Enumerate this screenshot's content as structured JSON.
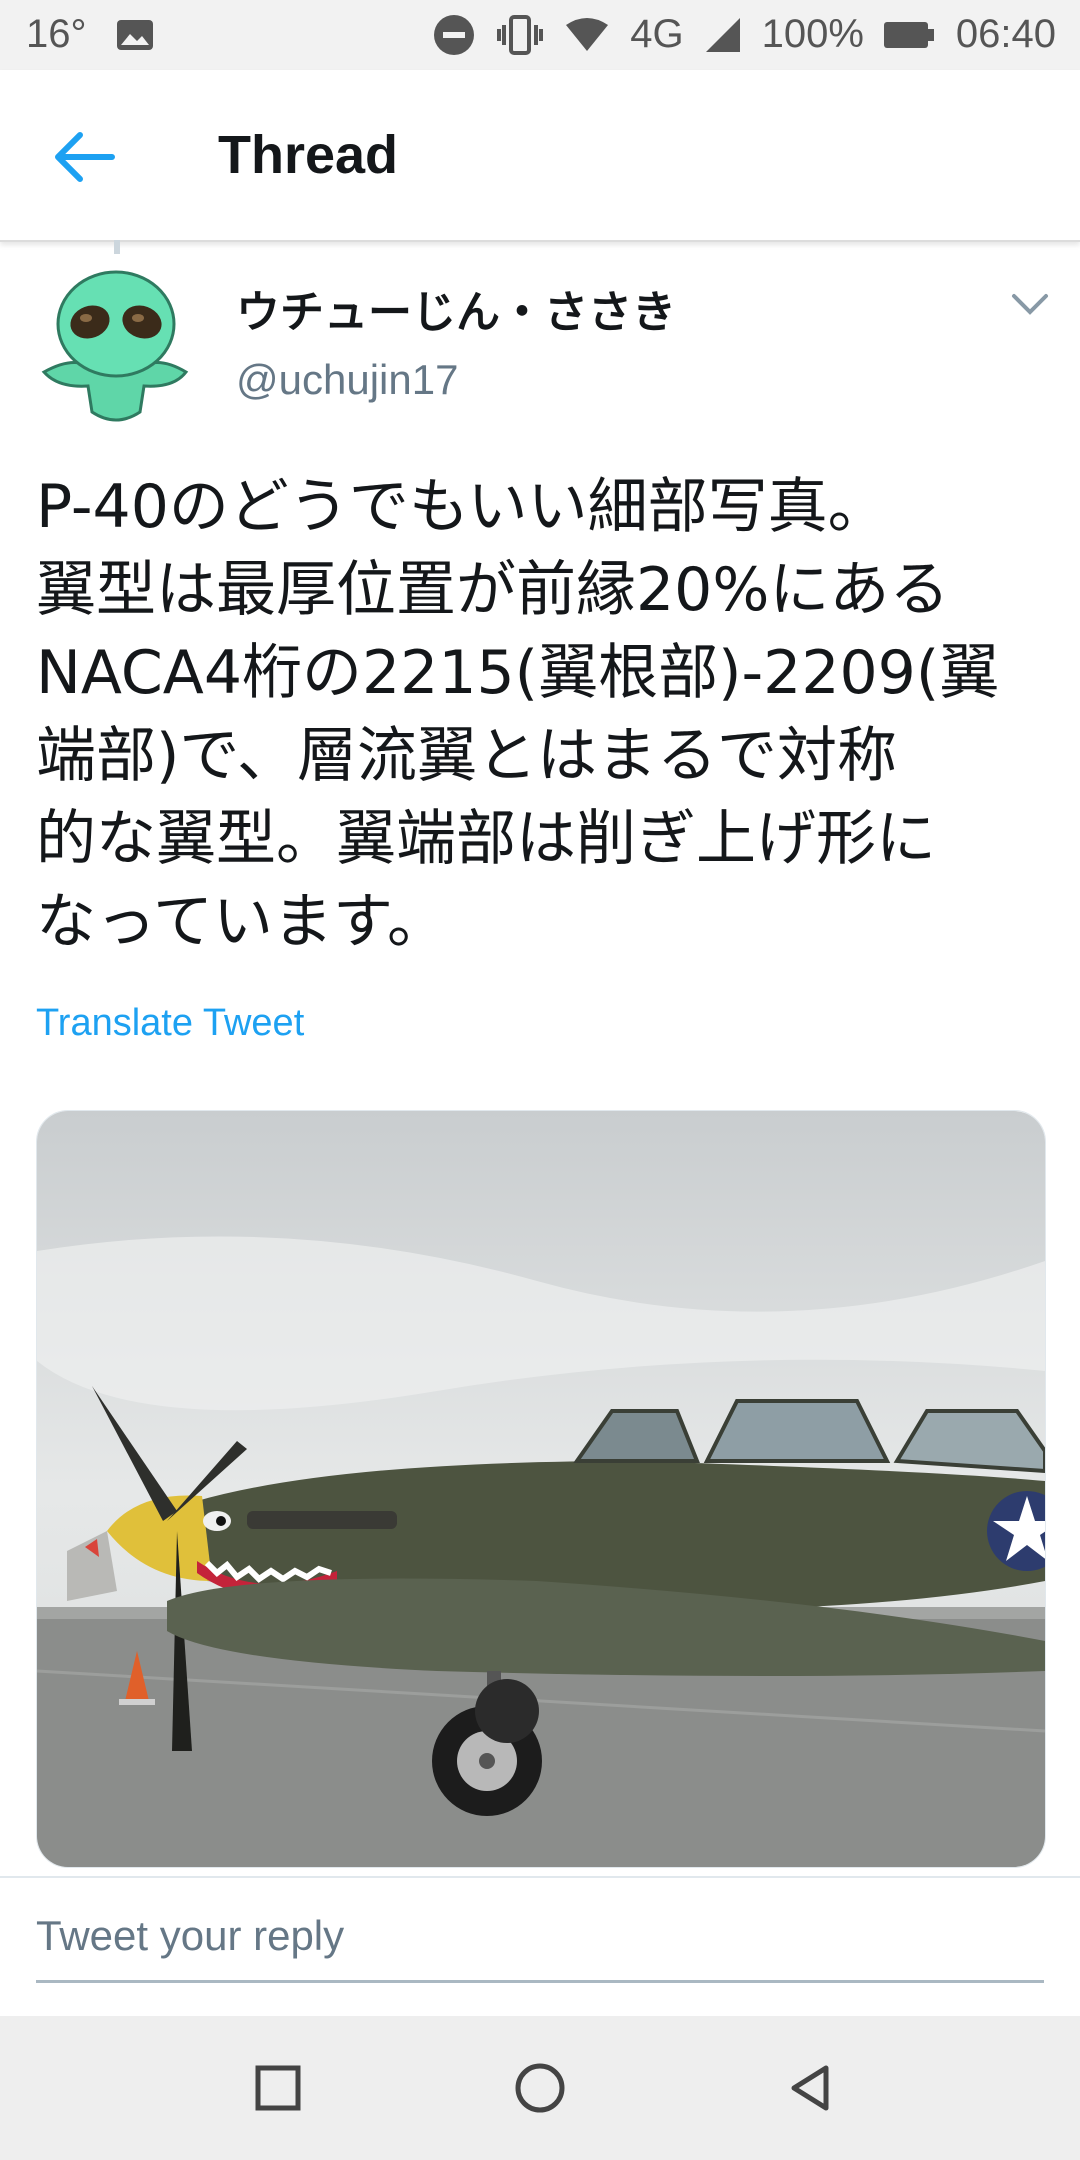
{
  "status_bar": {
    "temperature": "16°",
    "network": "4G",
    "battery": "100%",
    "time": "06:40",
    "icons": [
      "image-icon",
      "do-not-disturb-icon",
      "vibrate-icon",
      "wifi-icon",
      "signal-icon",
      "battery-icon"
    ]
  },
  "header": {
    "title": "Thread",
    "back_icon": "back-arrow-icon",
    "accent_color": "#1da1f2"
  },
  "tweet": {
    "display_name": "ウチューじん・ささき",
    "handle": "@uchujin17",
    "text": "P-40のどうでもいい細部写真。\n翼型は最厚位置が前縁20%にある\nNACA4桁の2215(翼根部)-2209(翼\n端部)で、層流翼とはまるで対称\n的な翼型。翼端部は削ぎ上げ形に\nなっています。",
    "translate_label": "Translate Tweet",
    "caret_icon": "chevron-down-icon",
    "avatar_icon": "alien-avatar"
  },
  "reply": {
    "placeholder": "Tweet your reply"
  },
  "nav": {
    "icons": [
      "recents-square-icon",
      "home-circle-icon",
      "back-triangle-icon"
    ]
  }
}
